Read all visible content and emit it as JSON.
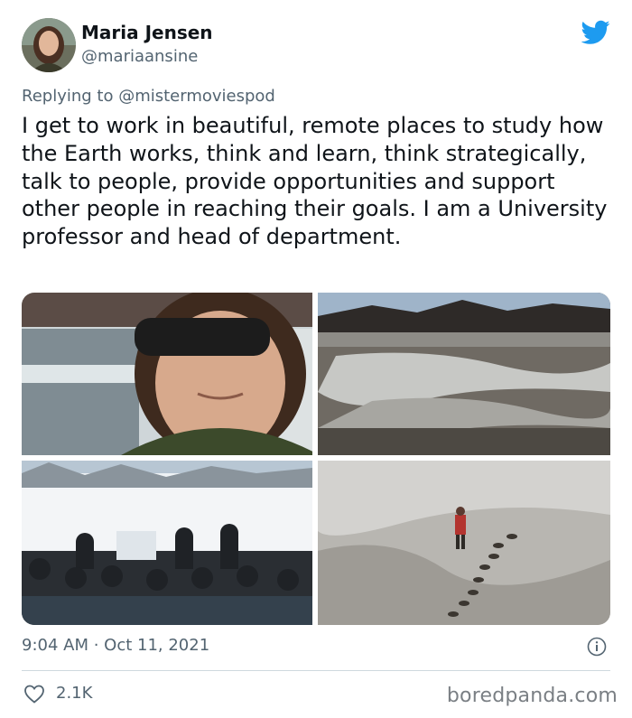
{
  "tweet": {
    "author_name": "Maria Jensen",
    "author_handle": "@mariaansine",
    "reply_to": "Replying to @mistermoviespod",
    "text": "I get to work in beautiful, remote places to study how the Earth works, think and learn, think strategically, talk to people, provide opportunities and support other people in reaching their goals. I am a University professor and head of department.",
    "timestamp": "9:04 AM · Oct 11, 2021",
    "likes": "2.1K"
  },
  "icons": {
    "brand": "twitter-bird-icon",
    "info": "info-icon",
    "like": "heart-icon"
  },
  "colors": {
    "twitter_blue": "#1d9bf0",
    "secondary_text": "#536471",
    "divider": "#cfd9de"
  },
  "watermark": "boredpanda.com"
}
